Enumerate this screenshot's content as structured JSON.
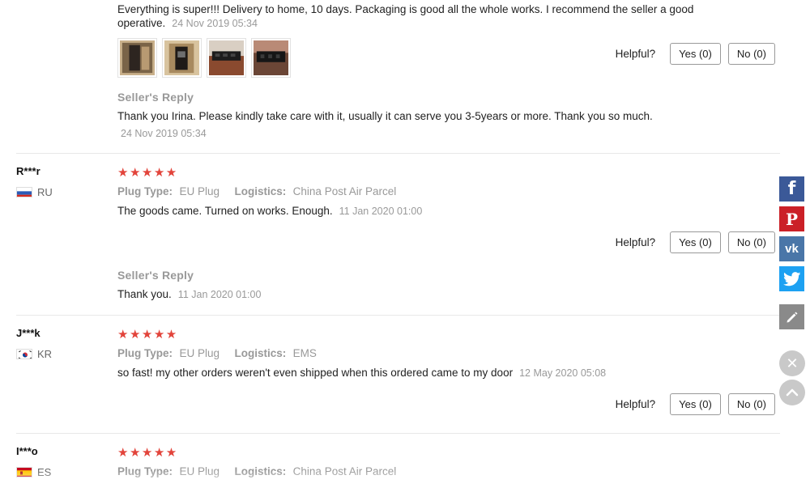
{
  "top_review": {
    "text": "Everything is super!!! Delivery to home, 10 days. Packaging is good all the whole works. I recommend the seller a good operative.",
    "date": "24 Nov 2019 05:34",
    "thumbnails": [
      "photo-1",
      "photo-2",
      "photo-3",
      "photo-4"
    ],
    "helpful_label": "Helpful?",
    "yes_label": "Yes (0)",
    "no_label": "No (0)",
    "seller_reply_label": "Seller's Reply",
    "seller_reply_text": "Thank you Irina. Please kindly take care with it, usually it can serve you 3-5years or more. Thank you so much.",
    "seller_reply_date": "24 Nov 2019 05:34"
  },
  "reviews": [
    {
      "name": "R***r",
      "country": "RU",
      "stars": "★★★★★",
      "plug_label": "Plug Type:",
      "plug_value": "EU Plug",
      "logistics_label": "Logistics:",
      "logistics_value": "China Post Air Parcel",
      "text": "The goods came. Turned on works. Enough.",
      "date": "11 Jan 2020 01:00",
      "helpful_label": "Helpful?",
      "yes_label": "Yes (0)",
      "no_label": "No (0)",
      "seller_reply_label": "Seller's Reply",
      "seller_reply_text": "Thank you.",
      "seller_reply_date": "11 Jan 2020 01:00"
    },
    {
      "name": "J***k",
      "country": "KR",
      "stars": "★★★★★",
      "plug_label": "Plug Type:",
      "plug_value": "EU Plug",
      "logistics_label": "Logistics:",
      "logistics_value": "EMS",
      "text": "so fast! my other orders weren't even shipped when this ordered came to my door",
      "date": "12 May 2020 05:08",
      "helpful_label": "Helpful?",
      "yes_label": "Yes (0)",
      "no_label": "No (0)"
    },
    {
      "name": "I***o",
      "country": "ES",
      "stars": "★★★★★",
      "plug_label": "Plug Type:",
      "plug_value": "EU Plug",
      "logistics_label": "Logistics:",
      "logistics_value": "China Post Air Parcel"
    }
  ],
  "social": {
    "facebook": "f",
    "pinterest": "P",
    "vk": "vk",
    "twitter": "twitter-icon",
    "edit": "pencil-icon",
    "close": "✕",
    "up": "︿"
  },
  "colors": {
    "star": "#e2443b",
    "facebook": "#3b5998",
    "pinterest": "#cb2027",
    "vk": "#4a76a8",
    "twitter": "#1da1f2",
    "edit": "#8a8a8a"
  }
}
